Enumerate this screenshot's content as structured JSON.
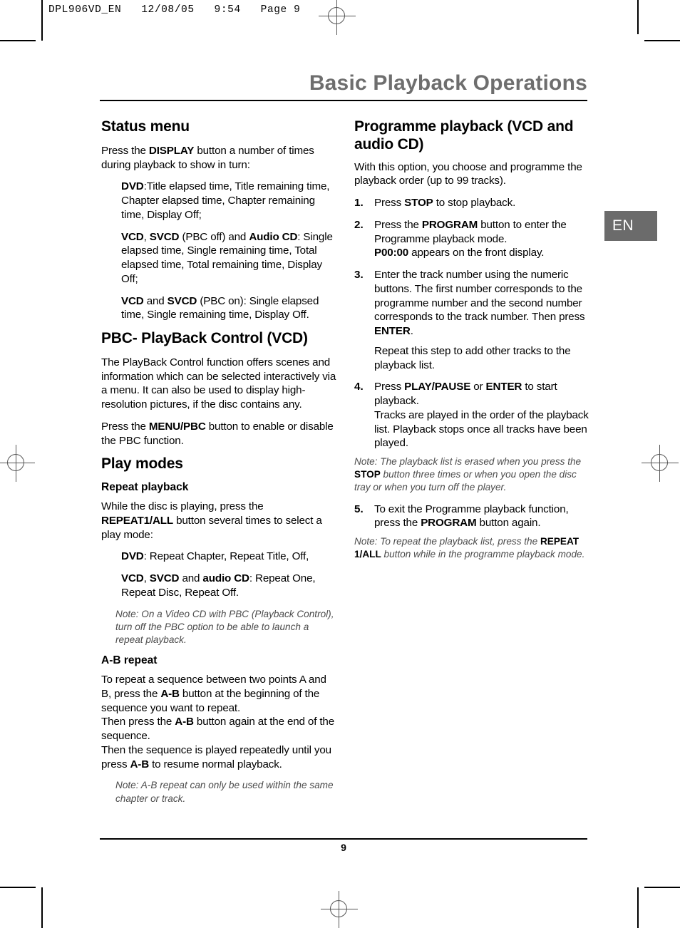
{
  "print_stamp": "DPL906VD_EN   12/08/05   9:54   Page 9",
  "header": {
    "title": "Basic Playback Operations"
  },
  "language_tab": {
    "label": "EN",
    "bg_color": "#6b6b6b",
    "text_color": "#ffffff"
  },
  "left_column": {
    "status_menu": {
      "heading": "Status menu",
      "intro_a": "Press the ",
      "intro_b": "DISPLAY",
      "intro_c": " button a number of times during playback to show in turn:",
      "items": [
        {
          "label": "DVD",
          "text": ":Title elapsed time, Title remaining time, Chapter elapsed time, Chapter remaining time, Display Off;"
        },
        {
          "label_a": "VCD",
          "sep1": ", ",
          "label_b": "SVCD",
          "mid": " (PBC off) and ",
          "label_c": "Audio CD",
          "text": ": Single elapsed time, Single remaining time, Total elapsed time, Total remaining time, Display Off;"
        },
        {
          "label_a": "VCD",
          "mid1": " and ",
          "label_b": "SVCD",
          "text": " (PBC on): Single elapsed time, Single remaining time, Display Off."
        }
      ]
    },
    "pbc": {
      "heading": "PBC- PlayBack Control (VCD)",
      "para1": "The PlayBack Control function offers scenes and information which can be selected interactively via a menu. It can also be used to display high-resolution pictures, if the disc contains any.",
      "para2_a": "Press the ",
      "para2_b": "MENU/PBC",
      "para2_c": " button to enable or disable the PBC function."
    },
    "play_modes": {
      "heading": "Play modes",
      "repeat": {
        "subheading": "Repeat playback",
        "intro_a": "While the disc is playing, press the ",
        "intro_b": "REPEAT1/ALL",
        "intro_c": " button several times to select a play mode:",
        "item1_label": "DVD",
        "item1_text": ": Repeat Chapter, Repeat Title, Off,",
        "item2_label_a": "VCD",
        "item2_sep": ", ",
        "item2_label_b": "SVCD",
        "item2_mid": " and ",
        "item2_label_c": "audio CD",
        "item2_text": ": Repeat One, Repeat Disc, Repeat Off.",
        "note": "Note: On a Video CD with PBC (Playback Control), turn off the PBC option to be able to launch a repeat playback."
      },
      "ab_repeat": {
        "subheading": "A-B repeat",
        "p1_a": "To repeat a sequence between two points A and B, press the ",
        "p1_b": "A-B",
        "p1_c": " button at the beginning of the sequence you want to repeat.",
        "p2_a": "Then press the ",
        "p2_b": "A-B",
        "p2_c": " button again at the end of the sequence.",
        "p3_a": "Then the sequence is played repeatedly until you press ",
        "p3_b": "A-B",
        "p3_c": " to resume normal playback.",
        "note": "Note: A-B repeat can only be used within the same chapter or track."
      }
    }
  },
  "right_column": {
    "programme": {
      "heading": "Programme playback (VCD and audio CD)",
      "intro": "With this option, you choose and programme the playback order (up to 99 tracks).",
      "steps": [
        {
          "num": "1.",
          "a": "Press ",
          "b": "STOP",
          "c": " to stop playback."
        },
        {
          "num": "2.",
          "a": "Press the ",
          "b": "PROGRAM",
          "c": " button to enter the Programme playback mode.",
          "d": "P00:00",
          "e": " appears on the front display."
        },
        {
          "num": "3.",
          "a": "Enter the track number using the numeric buttons. The first number corresponds to the programme number and the second number corresponds to the track number. Then press ",
          "b": "ENTER",
          "c": ".",
          "cont": "Repeat this step to add other tracks to the playback list."
        },
        {
          "num": "4.",
          "a": "Press ",
          "b": "PLAY/PAUSE",
          "c": " or ",
          "d": "ENTER",
          "e": " to start playback.",
          "f": "Tracks are played in the order of the playback list. Playback stops once all tracks have been played.",
          "note_a": "Note: The playback list is erased when you press the ",
          "note_b": "STOP",
          "note_c": " button three times or when you open the disc tray or when you turn off the player."
        },
        {
          "num": "5.",
          "a": "To exit the Programme playback function, press the ",
          "b": "PROGRAM",
          "c": " button again.",
          "note_a": "Note: To repeat the playback list, press the ",
          "note_b": "REPEAT 1/ALL",
          "note_c": " button while in the programme playback mode."
        }
      ]
    }
  },
  "footer": {
    "page_number": "9"
  }
}
